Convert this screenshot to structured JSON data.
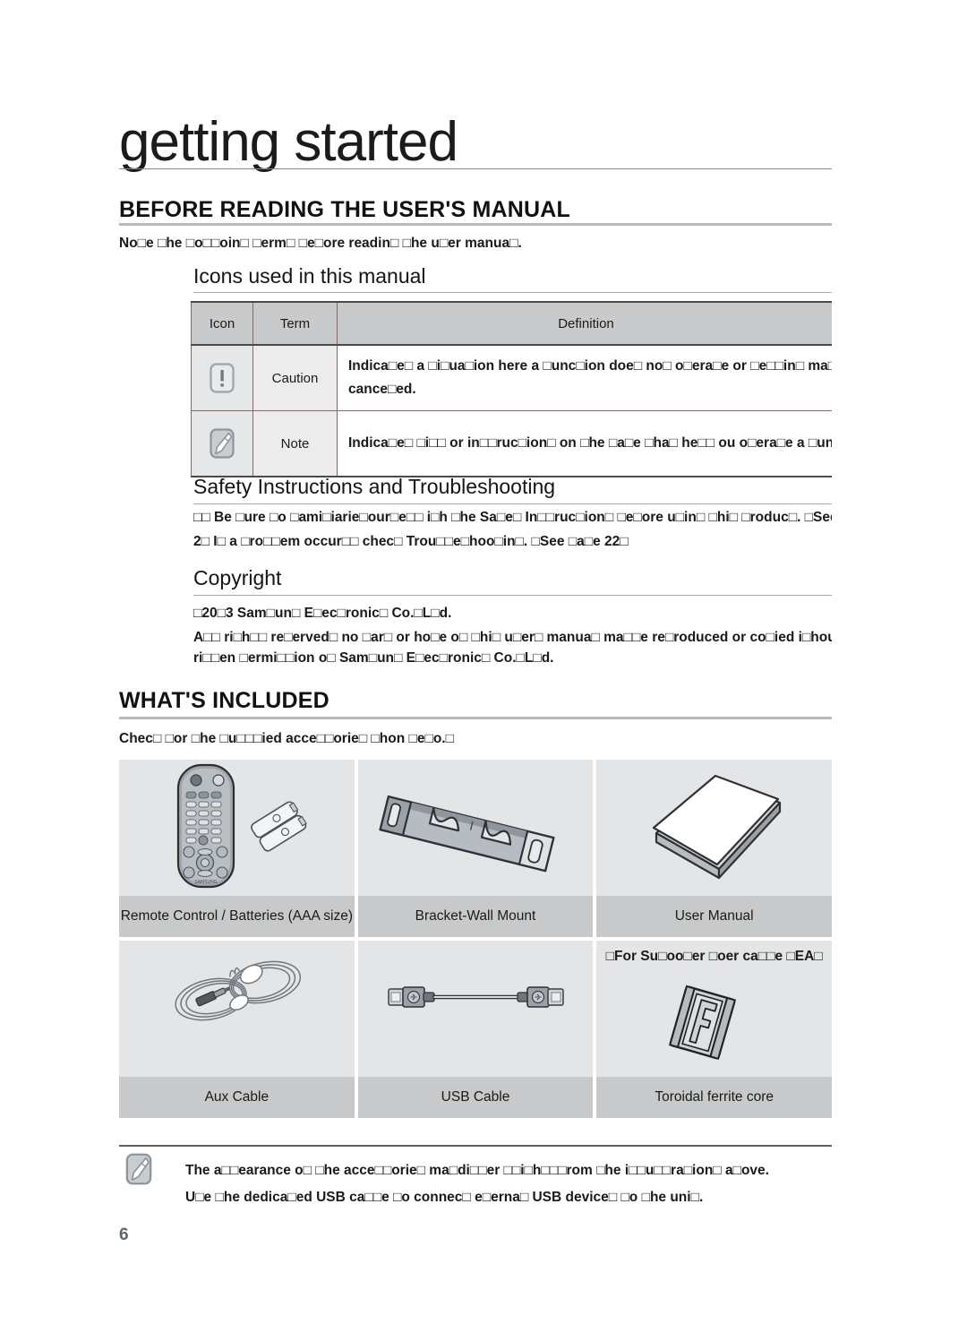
{
  "page": {
    "chapter_title": "getting started",
    "page_number": "6"
  },
  "section_before_reading": {
    "heading": "BEFORE READING THE USER'S MANUAL",
    "intro": "No□e □he □o□□oin□ □erm□ □e□ore readin□ □he u□er manua□."
  },
  "icons_subsection": {
    "heading": "Icons used in this manual",
    "table": {
      "columns": [
        "Icon",
        "Term",
        "Definition"
      ],
      "rows": [
        {
          "icon": "caution-icon",
          "term": "Caution",
          "definition_line1": "Indica□e□ a □i□ua□ion here a □unc□ion doe□ no□ o□era□e or □e□□in□ ma□□e",
          "definition_line2": "cance□ed."
        },
        {
          "icon": "note-icon",
          "term": "Note",
          "definition_line1": "Indica□e□ □i□□ or in□□ruc□ion□ on □he □a□e □ha□ he□□ ou o□era□e a □unc□ion",
          "definition_line2": ""
        }
      ]
    }
  },
  "safety_subsection": {
    "heading": "Safety Instructions and Troubleshooting",
    "line1": "□□  Be □ure □o □ami□iarie□our□e□□ i□h □he Sa□e□ In□□ruc□ion□ □e□ore u□in□ □hi□ □roduc□. □See □",
    "line2": "2□  I□ a □ro□□em occur□□ chec□ Trou□□e□hoo□in□. □See □a□e 22□"
  },
  "copyright_subsection": {
    "heading": "Copyright",
    "line1": "□20□3 Sam□un□ E□ec□ronic□ Co.□L□d.",
    "line2": "A□□ ri□h□□ re□erved□ no □ar□ or ho□e o□ □hi□ u□er□ manua□ ma□□e re□roduced or co□ied i□hou□ □h",
    "line3": "ri□□en □ermi□□ion o□ Sam□un□ E□ec□ronic□ Co.□L□d."
  },
  "section_whats_included": {
    "heading": "WHAT'S INCLUDED",
    "intro": "Chec□ □or □he □u□□□ied acce□□orie□ □hon □e□o.□",
    "accessories": [
      {
        "icon": "remote-control-and-batteries-image",
        "caption": "Remote Control / Batteries (AAA size)"
      },
      {
        "icon": "wall-mount-bracket-image",
        "caption": "Bracket-Wall Mount"
      },
      {
        "icon": "user-manual-image",
        "caption": "User Manual"
      },
      {
        "icon": "aux-cable-image",
        "caption": "Aux Cable"
      },
      {
        "icon": "usb-cable-image",
        "caption": "USB Cable"
      },
      {
        "icon": "toroidal-ferrite-core-image",
        "caption": "Toroidal ferrite core"
      }
    ],
    "ferrite_note": "□For Su□oo□er □oer ca□□e □EA□"
  },
  "bottom_note": {
    "icon": "note-icon",
    "line1": "The a□□earance o□ □he acce□□orie□ ma□di□□er □□i□h□□□rom □he i□□u□□ra□ion□ a□ove.",
    "line2": "U□e □he dedica□ed USB ca□□e □o connec□ e□erna□ USB device□ □o □he uni□."
  },
  "colors": {
    "table_header_bg": "#c8cacb",
    "cell_bg": "#e4e5e6",
    "caption_bg": "#c7c9ca",
    "rule_gray": "#b9b9b9",
    "page_number": "#5b676d"
  }
}
